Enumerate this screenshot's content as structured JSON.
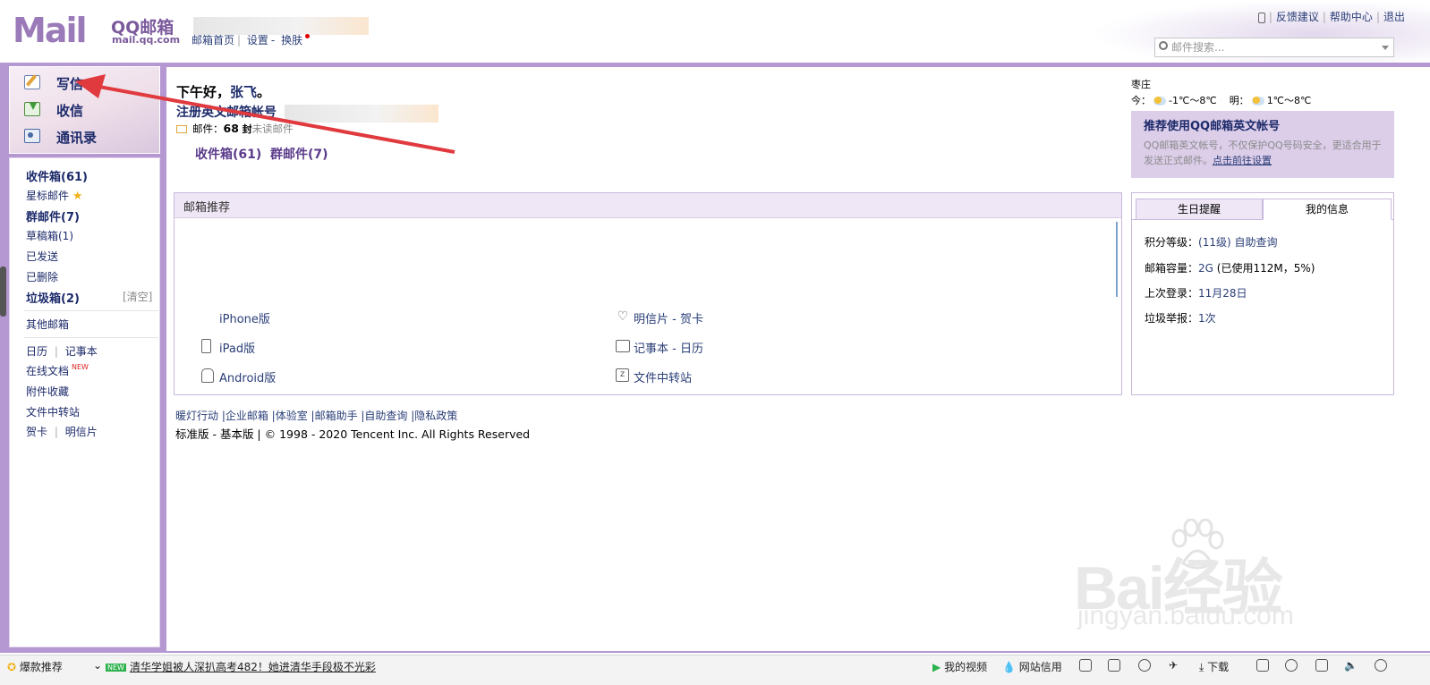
{
  "header": {
    "logo_text": "Mail",
    "logo_brand": "QQ邮箱",
    "logo_url": "mail.qq.com",
    "nav": {
      "home": "邮箱首页",
      "sep": "|",
      "settings": "设置",
      "dash": "-",
      "skin": "换肤"
    },
    "top_links": {
      "feedback": "反馈建议",
      "help": "帮助中心",
      "logout": "退出"
    },
    "search_placeholder": "邮件搜索..."
  },
  "left": {
    "commands": [
      {
        "label": "写信",
        "icon": "compose-icon"
      },
      {
        "label": "收信",
        "icon": "inbox-download-icon"
      },
      {
        "label": "通讯录",
        "icon": "contacts-icon"
      }
    ],
    "folders": {
      "inbox": "收件箱(61)",
      "starred": "星标邮件",
      "group": "群邮件(7)",
      "drafts": "草稿箱(1)",
      "sent": "已发送",
      "deleted": "已删除",
      "spam": "垃圾箱(2)",
      "spam_clear": "[清空]",
      "other": "其他邮箱",
      "calendar": "日历",
      "pipe": "|",
      "notes": "记事本",
      "docs": "在线文档",
      "docs_new": "NEW",
      "attach": "附件收藏",
      "transfer": "文件中转站",
      "card": "贺卡",
      "postcard": "明信片"
    }
  },
  "main": {
    "greeting_prefix": "下午好，",
    "greeting_name": "张飞",
    "greeting_suffix": "。",
    "register": "注册英文邮箱帐号",
    "unread_label": "邮件：",
    "unread_count": "68",
    "unread_unit": "封",
    "unread_text": "未读邮件",
    "inbox_link": "收件箱(61)",
    "group_link": "群邮件(7)"
  },
  "weather": {
    "city": "枣庄",
    "today_label": "今：",
    "today_temp": "-1℃～8℃",
    "tomorrow_label": "明：",
    "tomorrow_temp": "1℃～8℃"
  },
  "promo": {
    "title": "推荐使用QQ邮箱英文帐号",
    "body": "QQ邮箱英文帐号，不仅保护QQ号码安全，更适合用于发送正式邮件。",
    "link": "点击前往设置"
  },
  "recommend": {
    "title": "邮箱推荐",
    "items": [
      {
        "label": "iPhone版",
        "icon": "apple-icon"
      },
      {
        "label": "iPad版",
        "icon": "tablet-icon"
      },
      {
        "label": "Android版",
        "icon": "android-icon"
      },
      {
        "label": "明信片 - 贺卡",
        "icon": "heart-icon"
      },
      {
        "label": "记事本 - 日历",
        "icon": "calendar-icon"
      },
      {
        "label": "文件中转站",
        "icon": "file-transfer-icon"
      }
    ]
  },
  "side": {
    "tab_birthday": "生日提醒",
    "tab_info": "我的信息",
    "points_label": "积分等级：",
    "points_value": "(11级)",
    "points_link": "自助查询",
    "capacity_label": "邮箱容量：",
    "capacity_value": "2G",
    "capacity_used": "(已使用112M，5%)",
    "lastlogin_label": "上次登录：",
    "lastlogin_value": "11月28日",
    "spam_label": "垃圾举报：",
    "spam_value": "1次"
  },
  "footer": {
    "links": "暖灯行动 |企业邮箱 |体验室 |邮箱助手 |自助查询 |隐私政策",
    "copyright": "标准版 - 基本版 | © 1998 - 2020 Tencent Inc. All Rights Reserved"
  },
  "watermark": {
    "brand": "Bai经验",
    "url": "jingyan.baidu.com"
  },
  "statusbar": {
    "hot": "爆款推荐",
    "news_tag": "NEW",
    "news": "清华学姐被人深扒高考482！她进清华手段极不光彩",
    "video": "我的视频",
    "trust": "网站信用",
    "download": "下载"
  },
  "colors": {
    "accent": "#b597d1",
    "link": "#2a3e78",
    "arrow": "#e0393e"
  }
}
